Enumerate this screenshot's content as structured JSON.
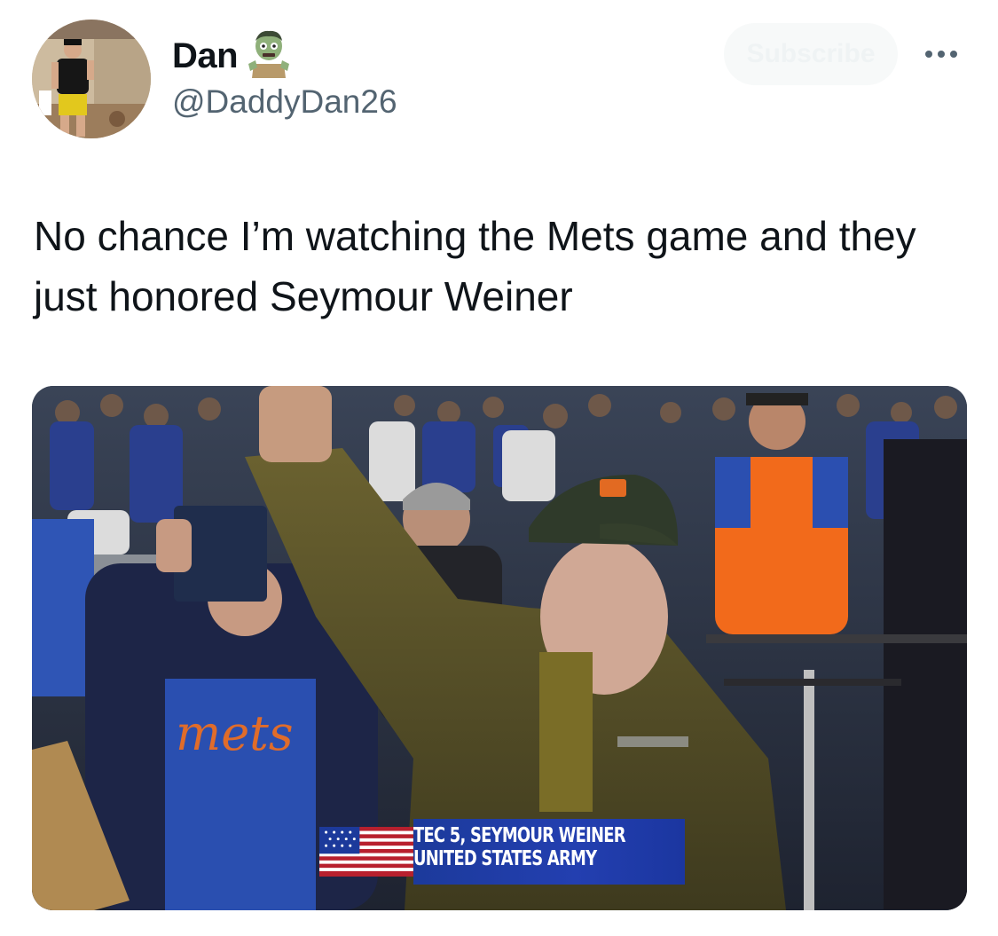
{
  "author": {
    "display_name": "Dan",
    "badge_emoji": "zombie",
    "handle": "@DaddyDan26"
  },
  "header": {
    "subscribe_label": "Subscribe",
    "more_icon": "more-horizontal-icon"
  },
  "tweet": {
    "text": "No chance I’m watching the Mets game and they just honored Seymour Weiner"
  },
  "media": {
    "caption_line1": "TEC 5, SEYMOUR WEINER",
    "caption_line2": "UNITED STATES ARMY",
    "jersey_text": "mets"
  },
  "colors": {
    "text_primary": "#0f1419",
    "text_secondary": "#536471",
    "mets_orange": "#f26a1b",
    "mets_blue": "#1c3a9b"
  }
}
